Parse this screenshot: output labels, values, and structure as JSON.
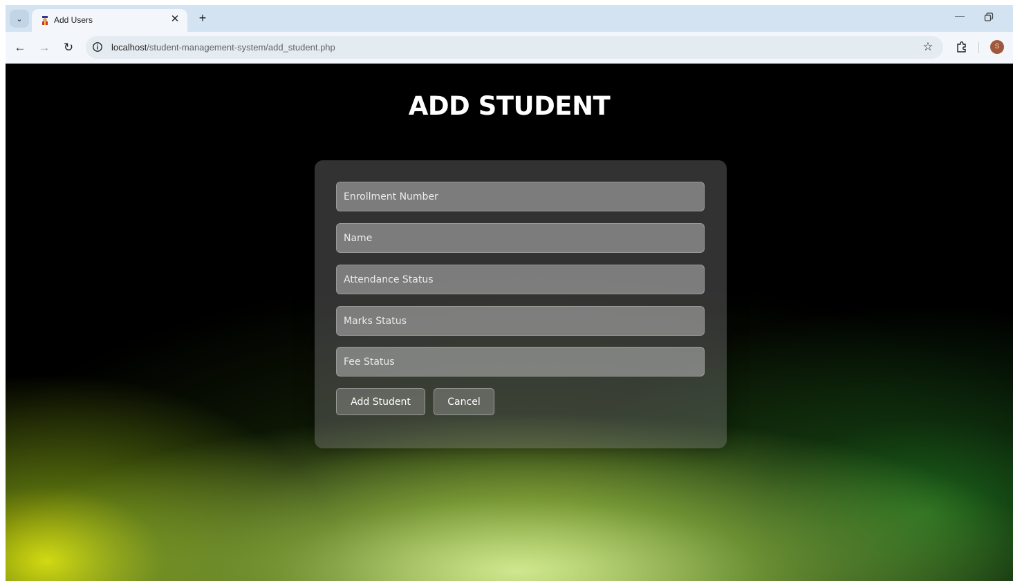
{
  "browser": {
    "tab": {
      "title": "Add Users",
      "close_glyph": "✕",
      "favicon": "student-graduation-cap-icon"
    },
    "new_tab_glyph": "+",
    "tab_search_glyph": "⌄",
    "window": {
      "minimize_glyph": "—"
    },
    "toolbar": {
      "back_glyph": "←",
      "forward_glyph": "→",
      "reload_glyph": "↻",
      "url_host": "localhost",
      "url_path": "/student-management-system/add_student.php",
      "bookmark_glyph": "☆",
      "profile_initial": "S"
    }
  },
  "page": {
    "title": "ADD STUDENT",
    "form": {
      "fields": [
        {
          "placeholder": "Enrollment Number",
          "value": ""
        },
        {
          "placeholder": "Name",
          "value": ""
        },
        {
          "placeholder": "Attendance Status",
          "value": ""
        },
        {
          "placeholder": "Marks Status",
          "value": ""
        },
        {
          "placeholder": "Fee Status",
          "value": ""
        }
      ],
      "submit_label": "Add Student",
      "cancel_label": "Cancel"
    }
  },
  "colors": {
    "tabstrip_bg": "#d3e3f1",
    "toolbar_bg": "#f3f7fb",
    "page_bg": "#000000",
    "glow_yellow": "#e2e60a",
    "glow_green": "#1e6e1e",
    "title_text": "#ffffff"
  }
}
